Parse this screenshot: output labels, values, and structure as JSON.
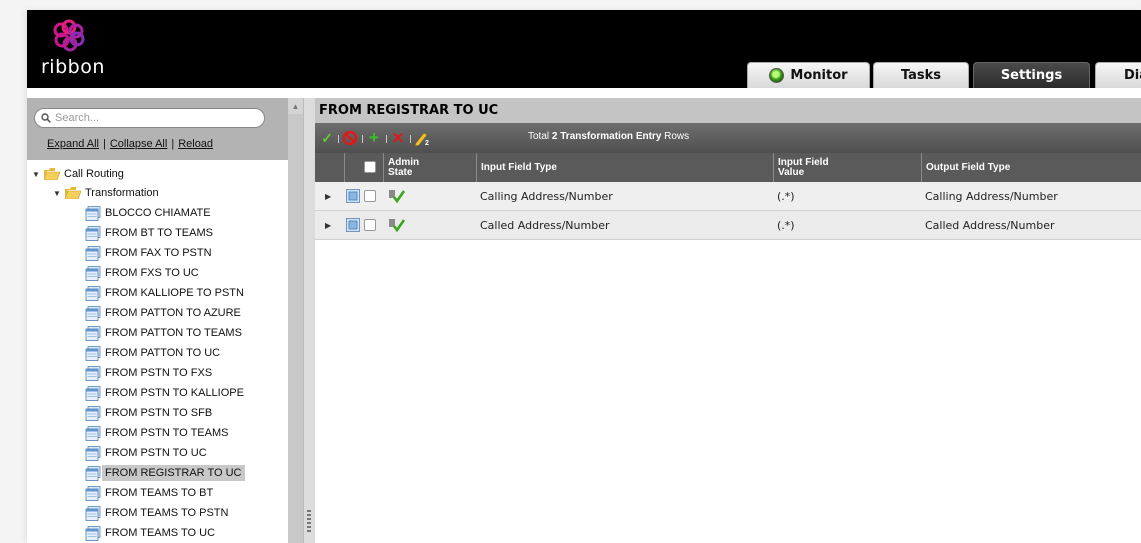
{
  "brand": {
    "name": "ribbon"
  },
  "tabs": [
    {
      "label": "Monitor"
    },
    {
      "label": "Tasks"
    },
    {
      "label": "Settings"
    },
    {
      "label": "Dia"
    }
  ],
  "sidebar": {
    "search_placeholder": "Search...",
    "links": {
      "expand_all": "Expand All",
      "collapse_all": "Collapse All",
      "reload": "Reload"
    },
    "tree": {
      "root": "Call Routing",
      "folder": "Transformation",
      "items": [
        "BLOCCO CHIAMATE",
        "FROM BT TO TEAMS",
        "FROM FAX TO PSTN",
        "FROM FXS TO UC",
        "FROM KALLIOPE TO PSTN",
        "FROM PATTON TO AZURE",
        "FROM PATTON TO TEAMS",
        "FROM PATTON TO UC",
        "FROM PSTN TO FXS",
        "FROM PSTN TO KALLIOPE",
        "FROM PSTN TO SFB",
        "FROM PSTN TO TEAMS",
        "FROM PSTN TO UC",
        "FROM REGISTRAR TO UC",
        "FROM TEAMS TO BT",
        "FROM TEAMS TO PSTN",
        "FROM TEAMS TO UC"
      ],
      "selected": "FROM REGISTRAR TO UC"
    }
  },
  "main": {
    "title": "FROM REGISTRAR TO UC",
    "toolbar": {
      "total_prefix": "Total ",
      "total_bold": "2 Transformation Entry",
      "total_suffix": " Rows"
    },
    "columns": {
      "admin_state_1": "Admin",
      "admin_state_2": "State",
      "input_field_type": "Input Field Type",
      "input_field_value_1": "Input Field",
      "input_field_value_2": "Value",
      "output_field_type": "Output Field Type"
    },
    "rows": [
      {
        "input_field_type": "Calling Address/Number",
        "input_field_value": "(.*)",
        "output_field_type": "Calling Address/Number"
      },
      {
        "input_field_type": "Called Address/Number",
        "input_field_value": "(.*)",
        "output_field_type": "Called Address/Number"
      }
    ]
  },
  "colors": {
    "header_bg": "#000000",
    "toolbar_bg": "#5a5a5a",
    "title_bar": "#c4c4c4",
    "logo_accent": "#c8168f"
  }
}
